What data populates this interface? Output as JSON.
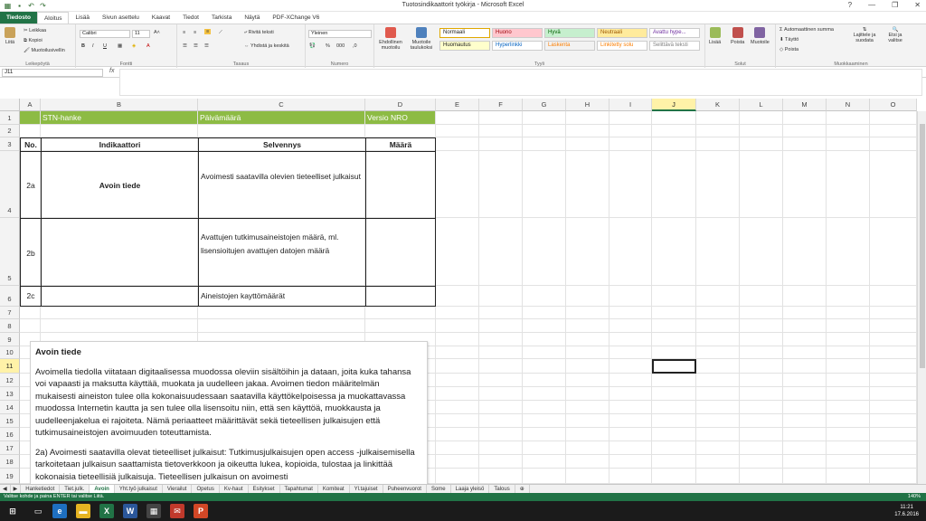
{
  "window": {
    "title": "Tuotosindikaattorit työkirja - Microsoft Excel"
  },
  "ribbon_tabs": [
    "Tiedosto",
    "Aloitus",
    "Lisää",
    "Sivun asettelu",
    "Kaavat",
    "Tiedot",
    "Tarkista",
    "Näytä",
    "PDF-XChange V6"
  ],
  "ribbon": {
    "clipboard": {
      "label": "Leikepöytä",
      "paste": "Liitä",
      "cut": "Leikkaa",
      "copy": "Kopioi",
      "format_painter": "Muotoilusivellin"
    },
    "font": {
      "label": "Fontti",
      "name": "Calibri",
      "size": "11"
    },
    "alignment": {
      "label": "Tasaus",
      "wrap": "Rivitä teksti",
      "merge": "Yhdistä ja keskitä"
    },
    "number": {
      "label": "Numero",
      "format": "Yleinen"
    },
    "styles": {
      "label": "Tyyli",
      "conditional": "Ehdollinen muotoilu",
      "table": "Muotoile taulukoksi",
      "items": [
        {
          "text": "Normaali",
          "bg": "#ffffff",
          "fg": "#222222"
        },
        {
          "text": "Huono",
          "bg": "#ffc7ce",
          "fg": "#9c0006"
        },
        {
          "text": "Hyvä",
          "bg": "#c6efce",
          "fg": "#006100"
        },
        {
          "text": "Neutraali",
          "bg": "#ffeb9c",
          "fg": "#9c5700"
        },
        {
          "text": "Avattu hype...",
          "bg": "#ffffff",
          "fg": "#7030a0"
        },
        {
          "text": "Huomautus",
          "bg": "#ffffcc",
          "fg": "#222222"
        },
        {
          "text": "Hyperlinkki",
          "bg": "#ffffff",
          "fg": "#0563c1"
        },
        {
          "text": "Laskenta",
          "bg": "#f2f2f2",
          "fg": "#fa7d00"
        },
        {
          "text": "Linkitetty solu",
          "bg": "#ffffff",
          "fg": "#fa7d00"
        },
        {
          "text": "Selittävä teksti",
          "bg": "#ffffff",
          "fg": "#7f7f7f"
        }
      ]
    },
    "cells": {
      "label": "Solut",
      "insert": "Lisää",
      "delete": "Poista",
      "format": "Muotoile"
    },
    "editing": {
      "label": "Muokkaaminen",
      "autosum": "Automaattinen summa",
      "fill": "Täyttö",
      "clear": "Poista",
      "sort": "Lajittele ja suodata",
      "find": "Etsi ja valitse"
    }
  },
  "formula_bar": {
    "name_box": "J11",
    "fx": "fx",
    "value": ""
  },
  "columns": [
    "A",
    "B",
    "C",
    "D",
    "E",
    "F",
    "G",
    "H",
    "I",
    "J",
    "K",
    "L",
    "M",
    "N",
    "O"
  ],
  "rows": [
    "1",
    "2",
    "3",
    "4",
    "5",
    "6",
    "7",
    "8",
    "9",
    "10",
    "11",
    "12",
    "13",
    "14",
    "15",
    "16",
    "17",
    "18",
    "19"
  ],
  "sheet": {
    "r1": {
      "a": "STN-hanke",
      "c": "Päivämäärä",
      "d": "Versio NRO"
    },
    "r3": {
      "a": "No.",
      "b": "Indikaattori",
      "c": "Selvennys",
      "d": "Määrä"
    },
    "r4": {
      "a": "2a",
      "b": "Avoin tiede",
      "c": "Avoimesti saatavilla olevien tieteelliset julkaisut"
    },
    "r5": {
      "a": "2b",
      "c": "Avattujen tutkimusaineistojen määrä, ml. lisensioitujen avattujen datojen määrä"
    },
    "r6": {
      "a": "2c",
      "c": "Aineistojen kayttömäärät"
    }
  },
  "textbox": {
    "title": "Avoin tiede",
    "p1": "Avoimella tiedolla viitataan digitaalisessa muodossa oleviin sisältöihin ja dataan, joita kuka tahansa voi vapaasti ja maksutta käyttää, muokata ja uudelleen jakaa. Avoimen tiedon määritelmän mukaisesti aineiston tulee olla kokonaisuudessaan saatavilla käyttökelpoisessa ja muokattavassa muodossa Internetin kautta ja sen tulee olla lisensoitu niin, että sen käyttöä, muokkausta ja uudelleenjakelua ei rajoiteta. Nämä periaatteet määrittävät sekä tieteellisen julkaisujen että tutkimusaineistojen avoimuuden toteuttamista.",
    "p2": "2a) Avoimesti saatavilla olevat tieteelliset julkaisut: Tutkimusjulkaisujen open access -julkaisemisella tarkoitetaan julkaisun saattamista tietoverkkoon ja oikeutta lukea, kopioida, tulostaa ja linkittää kokonaisia tieteellisiä julkaisuja. Tieteellisen julkaisun on avoimesti"
  },
  "sheet_tabs": [
    "Hanketiedot",
    "Tiet.julk.",
    "Avoin",
    "Yht.työ julkaisut",
    "Vierailut",
    "Opetus",
    "Kv-haut",
    "Esitykset",
    "Tapahtumat",
    "Komiteat",
    "Yl.tajuiset",
    "Puheenvuorot",
    "Some",
    "Laaja yleisö",
    "Talous"
  ],
  "active_sheet": "Avoin",
  "status": {
    "text": "Valitse kohde ja paina ENTER tai valitse Liitä.",
    "zoom": "140%"
  },
  "clock": {
    "time": "11:21",
    "date": "17.6.2016"
  },
  "colors": {
    "excel_green": "#217346",
    "header_green": "#8dbb44"
  }
}
